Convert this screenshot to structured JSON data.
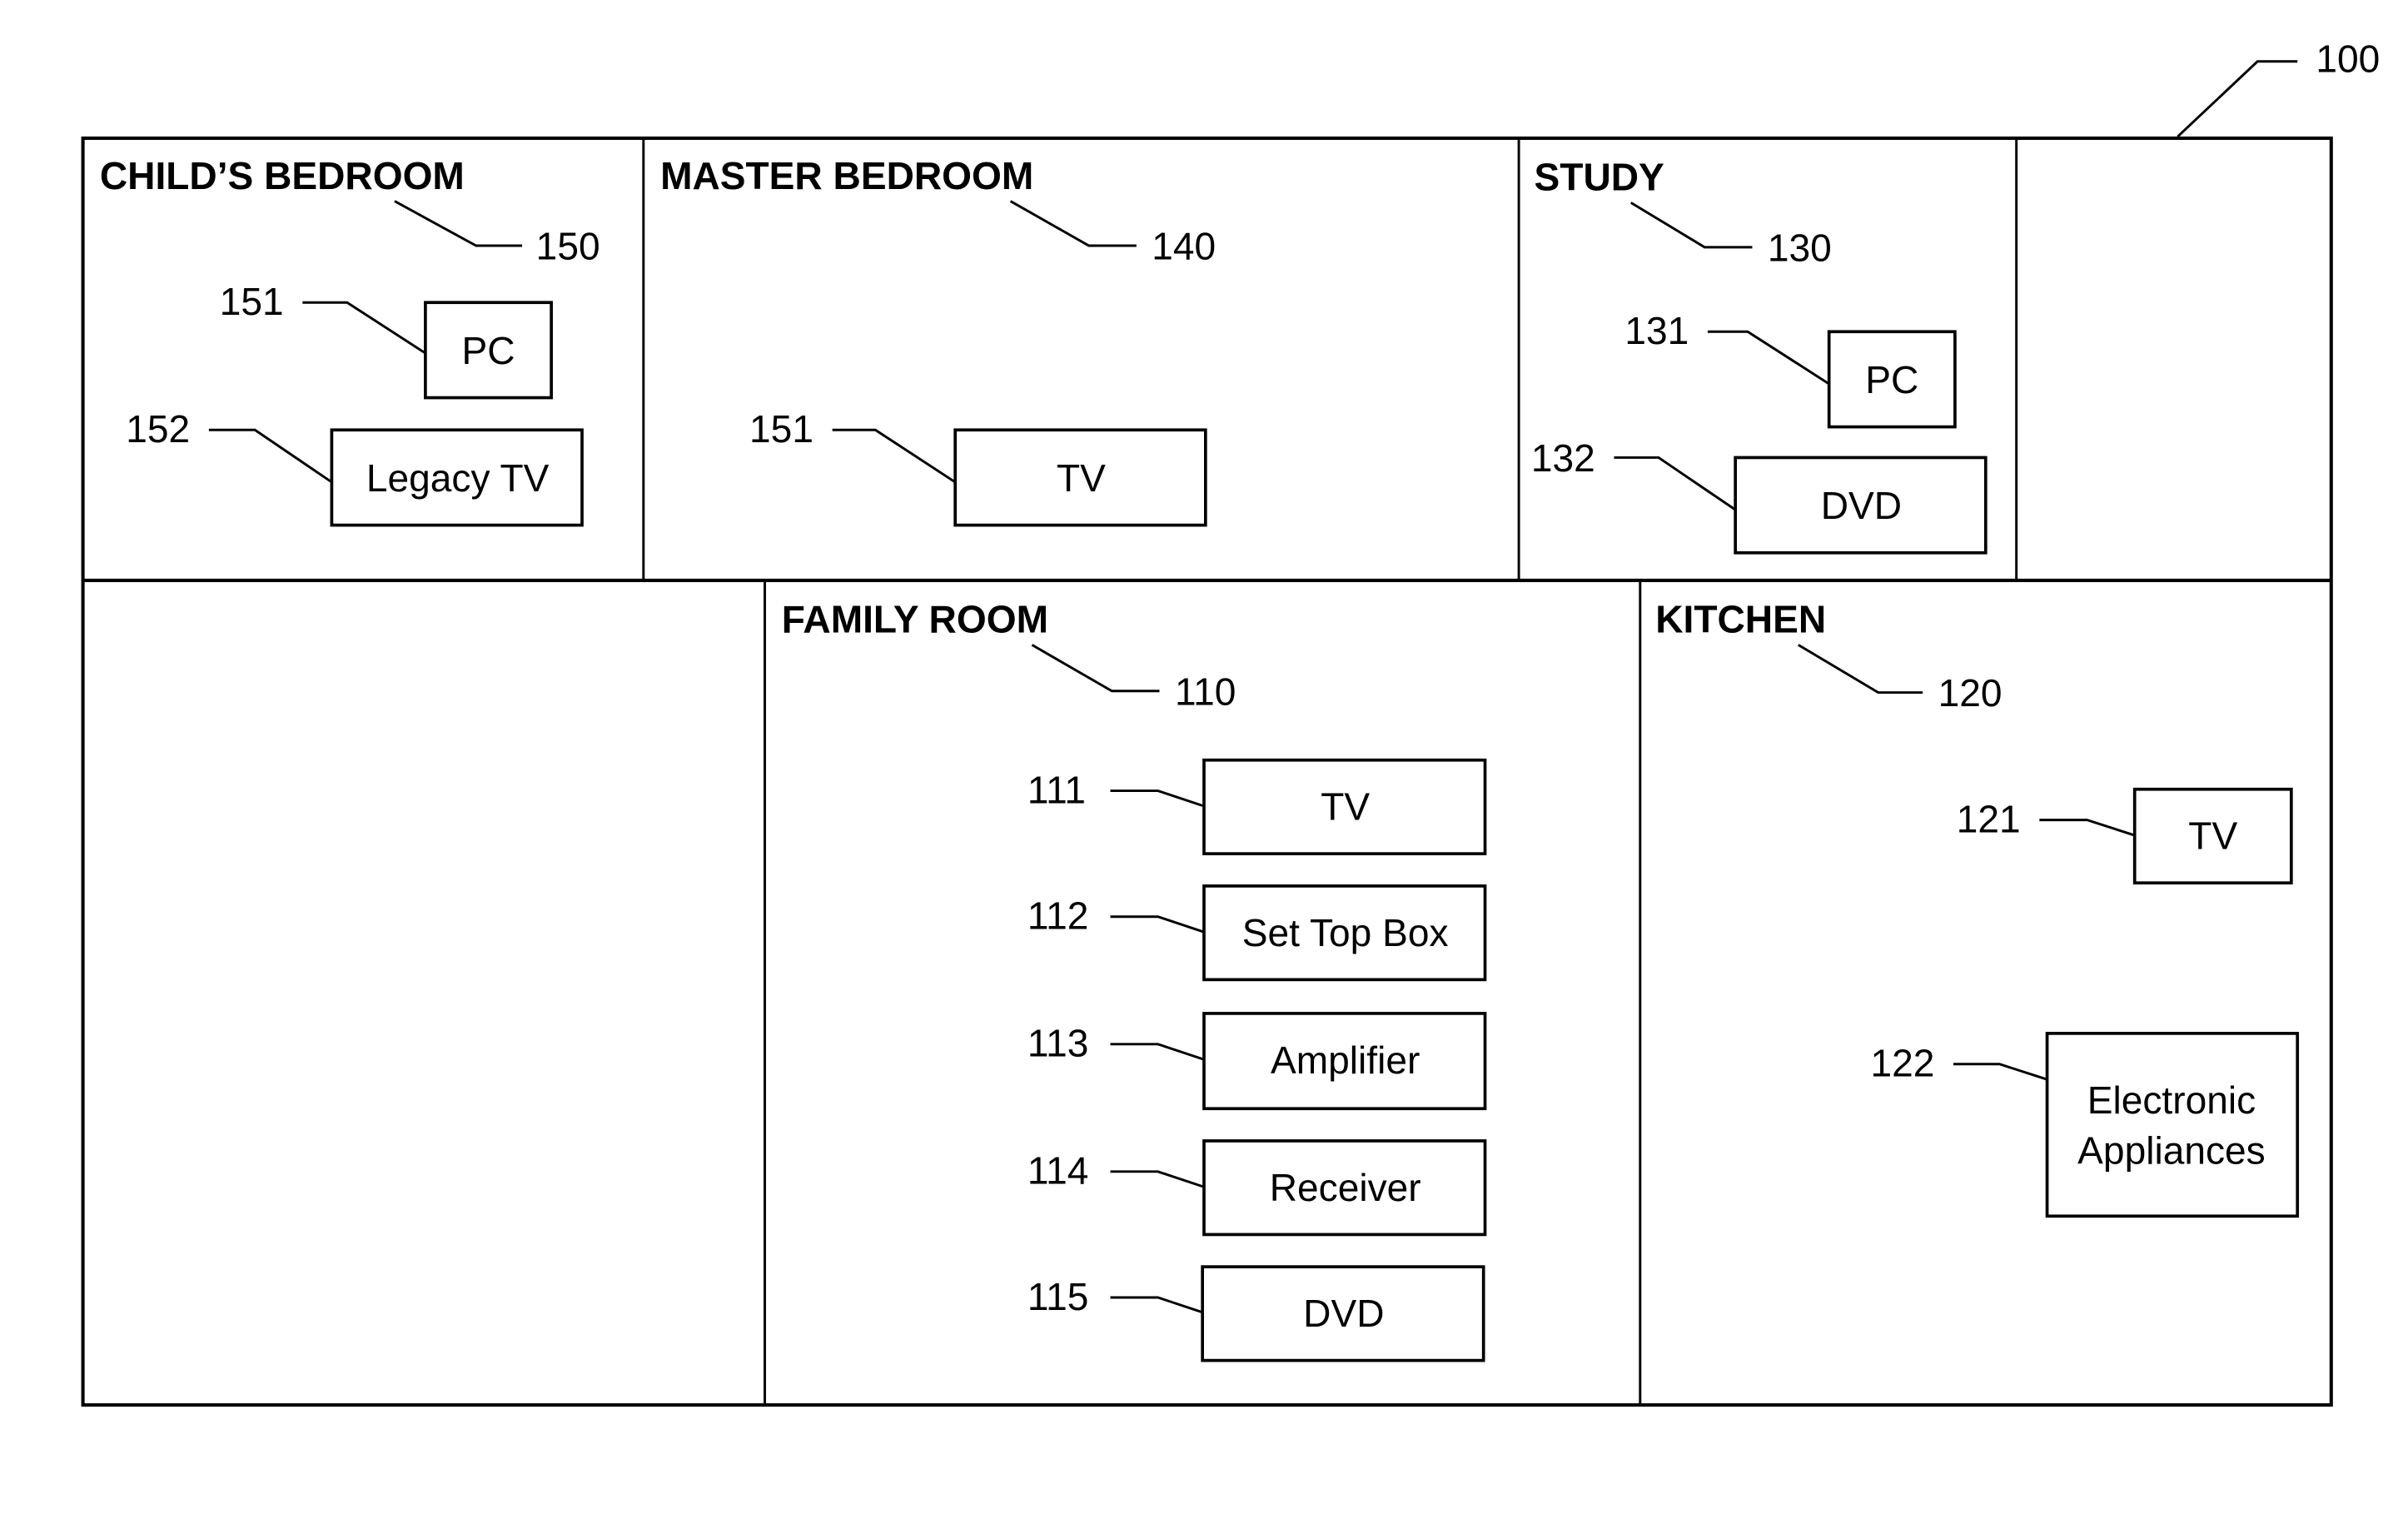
{
  "figure": {
    "reference": "100"
  },
  "rooms": {
    "childs_bedroom": {
      "title": "CHILD’S BEDROOM",
      "reference": "150",
      "devices": [
        {
          "reference": "151",
          "label": "PC"
        },
        {
          "reference": "152",
          "label": "Legacy TV"
        }
      ]
    },
    "master_bedroom": {
      "title": "MASTER BEDROOM",
      "reference": "140",
      "devices": [
        {
          "reference": "151",
          "label": "TV"
        }
      ]
    },
    "study": {
      "title": "STUDY",
      "reference": "130",
      "devices": [
        {
          "reference": "131",
          "label": "PC"
        },
        {
          "reference": "132",
          "label": "DVD"
        }
      ]
    },
    "family_room": {
      "title": "FAMILY ROOM",
      "reference": "110",
      "devices": [
        {
          "reference": "111",
          "label": "TV"
        },
        {
          "reference": "112",
          "label": "Set Top Box"
        },
        {
          "reference": "113",
          "label": "Amplifier"
        },
        {
          "reference": "114",
          "label": "Receiver"
        },
        {
          "reference": "115",
          "label": "DVD"
        }
      ]
    },
    "kitchen": {
      "title": "KITCHEN",
      "reference": "120",
      "devices": [
        {
          "reference": "121",
          "label": "TV"
        },
        {
          "reference": "122",
          "label_line1": "Electronic",
          "label_line2": "Appliances"
        }
      ]
    }
  },
  "colors": {
    "stroke": "#000000",
    "background": "#ffffff"
  }
}
